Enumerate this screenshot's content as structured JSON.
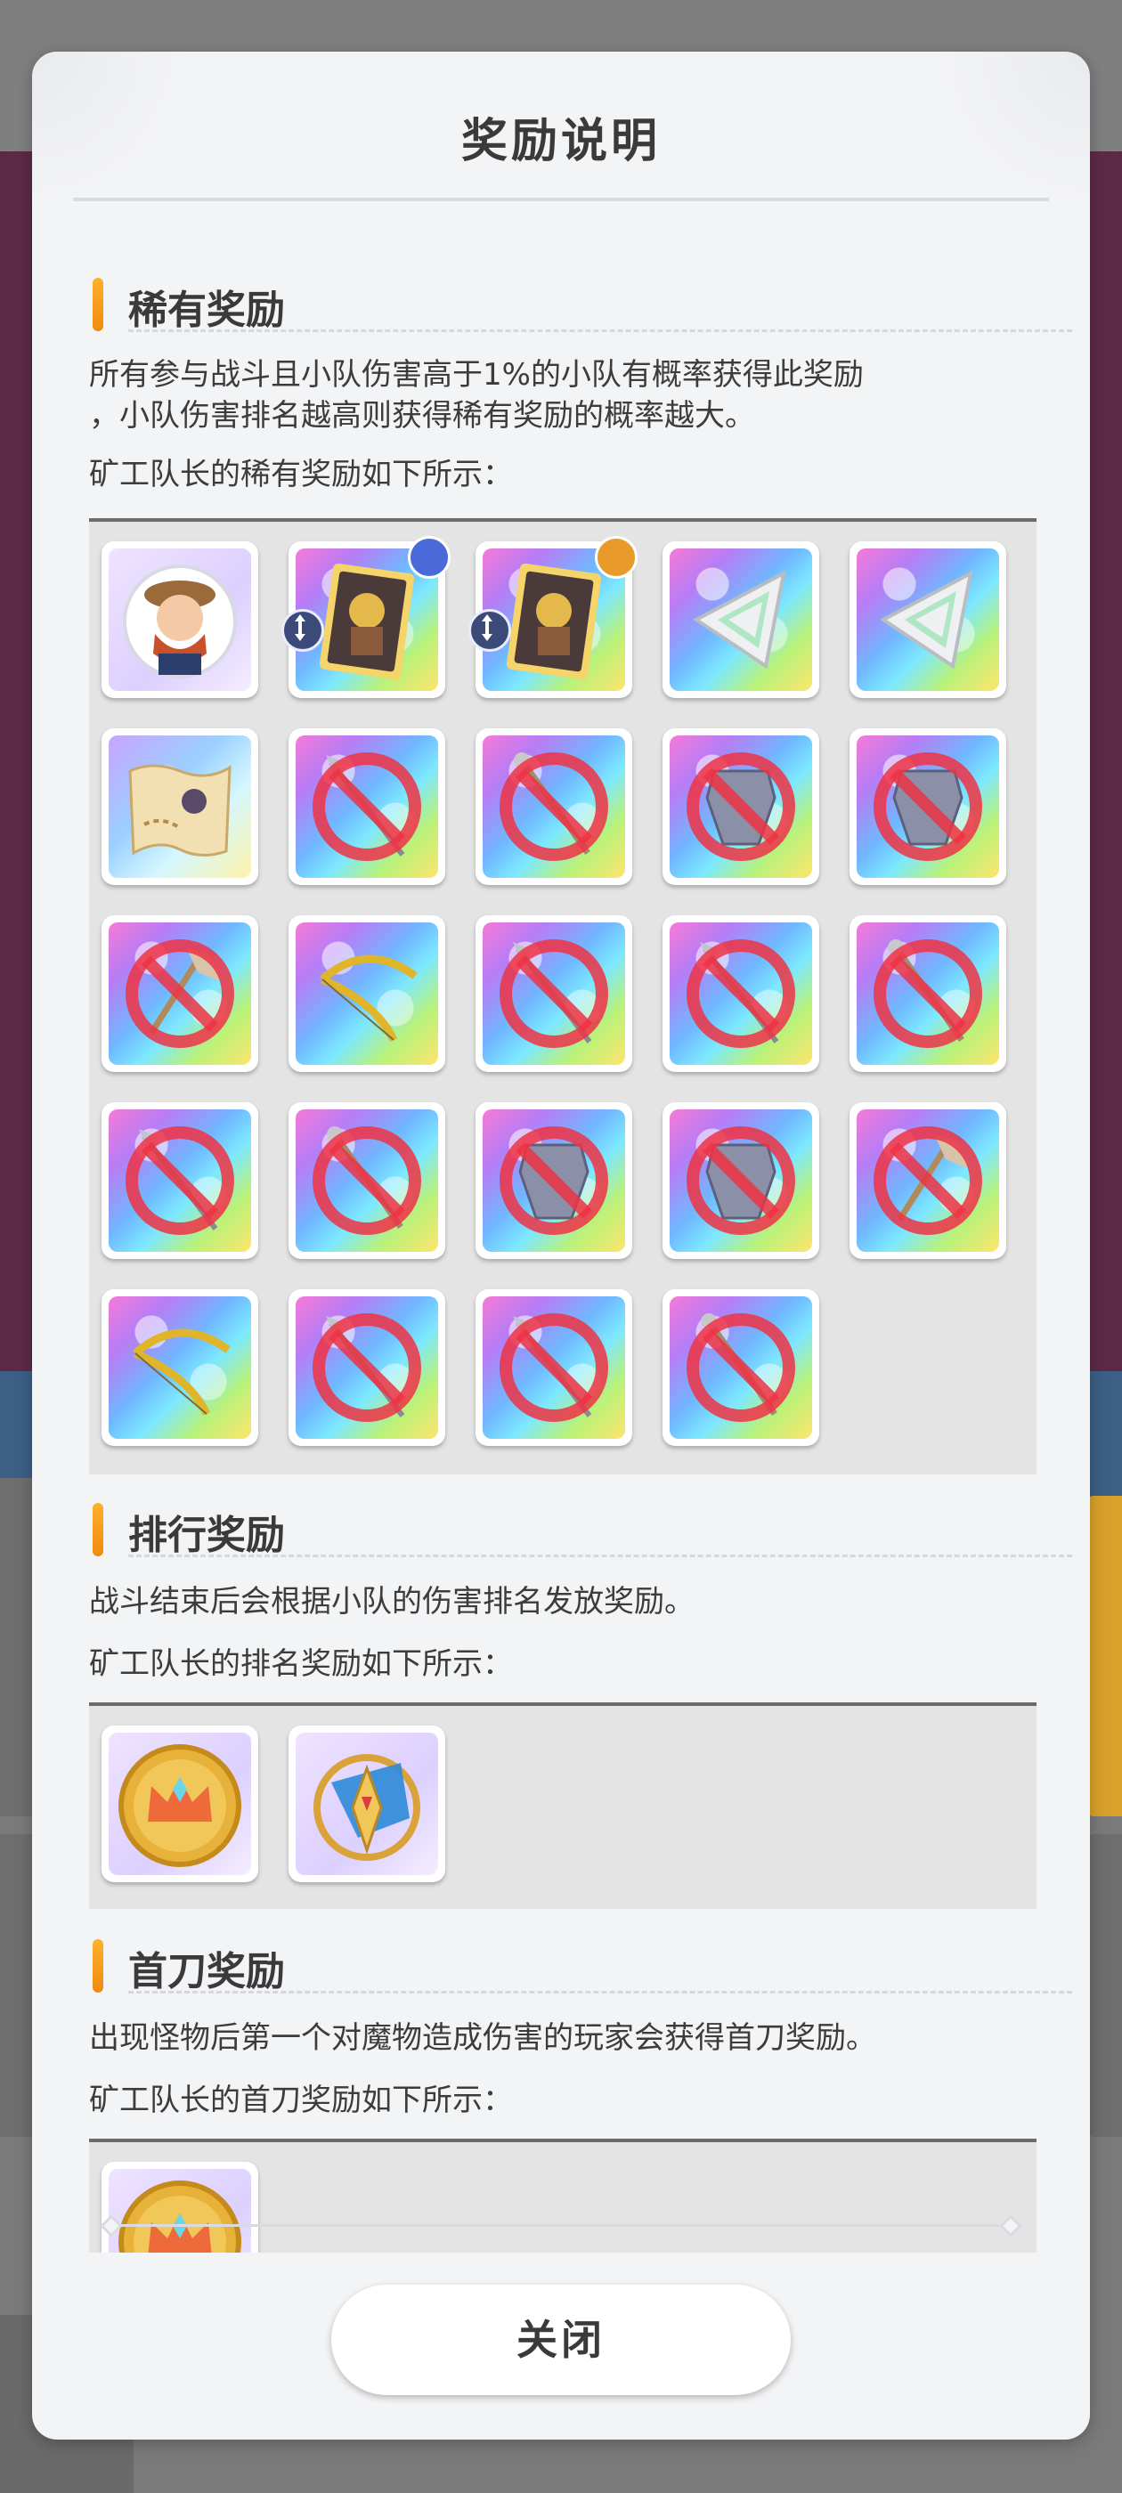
{
  "dialog": {
    "title": "奖励说明",
    "close_label": "关闭"
  },
  "rare": {
    "heading": "稀有奖励",
    "desc_line1": "所有参与战斗且小队伤害高于1%的小队有概率获得此奖励",
    "desc_line2": "，小队伤害排名越高则获得稀有奖励的概率越大。",
    "sub": "矿工队长的稀有奖励如下所示：",
    "items": [
      {
        "icon": "captain-portrait-icon"
      },
      {
        "icon": "character-card-icon"
      },
      {
        "icon": "character-card-icon"
      },
      {
        "icon": "triangle-gem-icon"
      },
      {
        "icon": "triangle-gem-icon"
      },
      {
        "icon": "treasure-map-icon"
      },
      {
        "icon": "prohibited-spear-icon"
      },
      {
        "icon": "prohibited-staff-icon"
      },
      {
        "icon": "prohibited-armor-icon"
      },
      {
        "icon": "prohibited-armor-icon"
      },
      {
        "icon": "prohibited-axe-icon"
      },
      {
        "icon": "bow-icon"
      },
      {
        "icon": "prohibited-spear-icon"
      },
      {
        "icon": "prohibited-spear-icon"
      },
      {
        "icon": "prohibited-staff-icon"
      },
      {
        "icon": "prohibited-spear-icon"
      },
      {
        "icon": "prohibited-staff-icon"
      },
      {
        "icon": "prohibited-armor-icon"
      },
      {
        "icon": "prohibited-armor-icon"
      },
      {
        "icon": "prohibited-axe-icon"
      },
      {
        "icon": "bow-icon"
      },
      {
        "icon": "prohibited-spear-icon"
      },
      {
        "icon": "prohibited-spear-icon"
      },
      {
        "icon": "prohibited-staff-icon"
      }
    ]
  },
  "ranking": {
    "heading": "排行奖励",
    "desc": "战斗结束后会根据小队的伤害排名发放奖励。",
    "sub": "矿工队长的排名奖励如下所示：",
    "items": [
      {
        "icon": "crown-coin-icon"
      },
      {
        "icon": "golden-emblem-icon"
      }
    ]
  },
  "first_blood": {
    "heading": "首刀奖励",
    "desc": "出现怪物后第一个对魔物造成伤害的玩家会获得首刀奖励。",
    "sub": "矿工队长的首刀奖励如下所示：",
    "items": [
      {
        "icon": "crown-coin-icon"
      }
    ]
  }
}
